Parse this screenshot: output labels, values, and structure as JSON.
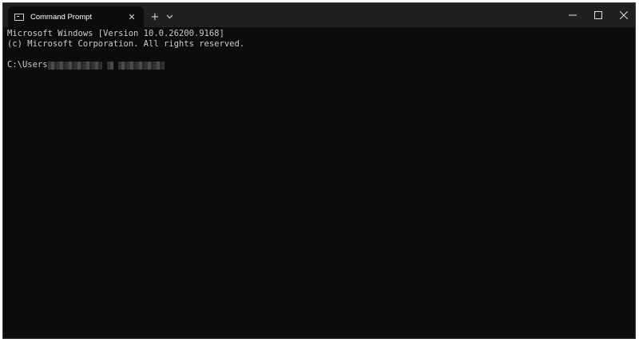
{
  "window": {
    "tab_title": "Command Prompt",
    "tab_icon": "terminal-icon",
    "tab_close_glyph": "✕",
    "new_tab_glyph": "+",
    "dropdown_icon": "chevron-down-icon",
    "controls": [
      "minimize-icon",
      "maximize-icon",
      "close-icon"
    ]
  },
  "terminal": {
    "lines": [
      "Microsoft Windows [Version 10.0.26200.9168]",
      "(c) Microsoft Corporation. All rights reserved."
    ],
    "prompt_prefix": "C:\\Users"
  },
  "colors": {
    "titlebar": "#202020",
    "background": "#0c0c0c",
    "text": "#cccccc"
  }
}
